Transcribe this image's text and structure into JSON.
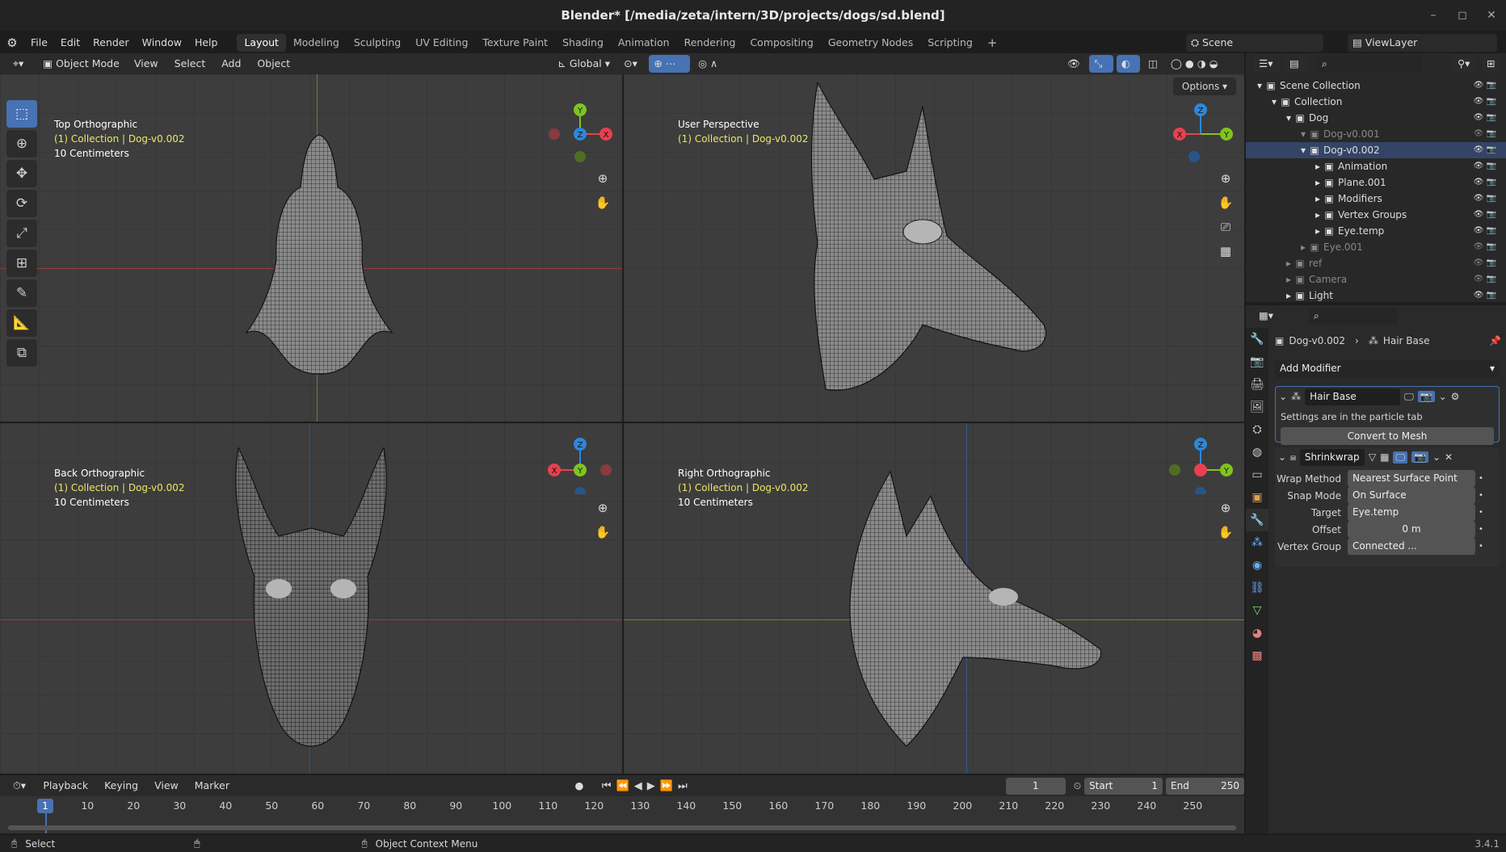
{
  "window": {
    "title": "Blender* [/media/zeta/intern/3D/projects/dogs/sd.blend]",
    "minimize": "–",
    "maximize": "◻",
    "close": "✕"
  },
  "menus": [
    "File",
    "Edit",
    "Render",
    "Window",
    "Help"
  ],
  "workspaces": [
    "Layout",
    "Modeling",
    "Sculpting",
    "UV Editing",
    "Texture Paint",
    "Shading",
    "Animation",
    "Rendering",
    "Compositing",
    "Geometry Nodes",
    "Scripting"
  ],
  "workspace_add": "+",
  "scene": {
    "label": "Scene"
  },
  "view_layer": {
    "label": "ViewLayer"
  },
  "viewport_header": {
    "mode": "Object Mode",
    "menus": [
      "View",
      "Select",
      "Add",
      "Object"
    ],
    "orientation": "Global",
    "options": "Options"
  },
  "viewports": [
    {
      "title": "Top Orthographic",
      "collection": "(1) Collection | Dog-v0.002",
      "scale": "10 Centimeters",
      "axes": [
        "Y",
        "X",
        "Z"
      ]
    },
    {
      "title": "User Perspective",
      "collection": "(1) Collection | Dog-v0.002",
      "scale": "",
      "axes": [
        "Z",
        "X",
        "Y"
      ]
    },
    {
      "title": "Back Orthographic",
      "collection": "(1) Collection | Dog-v0.002",
      "scale": "10 Centimeters",
      "axes": [
        "Z",
        "X",
        "Y"
      ]
    },
    {
      "title": "Right Orthographic",
      "collection": "(1) Collection | Dog-v0.002",
      "scale": "10 Centimeters",
      "axes": [
        "Z",
        "Y"
      ]
    }
  ],
  "outliner": {
    "rows": [
      {
        "label": "Scene Collection",
        "indent": 0,
        "dim": false
      },
      {
        "label": "Collection",
        "indent": 1,
        "dim": false
      },
      {
        "label": "Dog",
        "indent": 2,
        "dim": false
      },
      {
        "label": "Dog-v0.001",
        "indent": 3,
        "dim": true
      },
      {
        "label": "Dog-v0.002",
        "indent": 3,
        "dim": false
      },
      {
        "label": "Animation",
        "indent": 4,
        "dim": false
      },
      {
        "label": "Plane.001",
        "indent": 4,
        "dim": false
      },
      {
        "label": "Modifiers",
        "indent": 4,
        "dim": false
      },
      {
        "label": "Vertex Groups",
        "indent": 4,
        "dim": false
      },
      {
        "label": "Eye.temp",
        "indent": 4,
        "dim": false
      },
      {
        "label": "Eye.001",
        "indent": 3,
        "dim": true
      },
      {
        "label": "ref",
        "indent": 2,
        "dim": true
      },
      {
        "label": "Camera",
        "indent": 2,
        "dim": true
      },
      {
        "label": "Light",
        "indent": 2,
        "dim": false
      }
    ]
  },
  "properties": {
    "breadcrumb_object": "Dog-v0.002",
    "breadcrumb_modifier": "Hair Base",
    "add_modifier": "Add Modifier",
    "hair_base": {
      "name": "Hair Base",
      "note": "Settings are in the particle tab",
      "convert": "Convert to Mesh"
    },
    "shrinkwrap": {
      "name": "Shrinkwrap",
      "rows": [
        {
          "label": "Wrap Method",
          "value": "Nearest Surface Point"
        },
        {
          "label": "Snap Mode",
          "value": "On Surface"
        },
        {
          "label": "Target",
          "value": "Eye.temp"
        },
        {
          "label": "Offset",
          "value": "0 m"
        },
        {
          "label": "Vertex Group",
          "value": "Connected ..."
        }
      ]
    }
  },
  "timeline": {
    "menus": [
      "Playback",
      "Keying",
      "View",
      "Marker"
    ],
    "current_frame": "1",
    "start_label": "Start",
    "start": "1",
    "end_label": "End",
    "end": "250",
    "ticks": [
      "10",
      "20",
      "30",
      "40",
      "50",
      "60",
      "70",
      "80",
      "90",
      "100",
      "110",
      "120",
      "130",
      "140",
      "150",
      "160",
      "170",
      "180",
      "190",
      "200",
      "210",
      "220",
      "230",
      "240",
      "250"
    ],
    "playhead": "1"
  },
  "status": {
    "select": "Select",
    "context": "Object Context Menu",
    "version": "3.4.1"
  },
  "colors": {
    "accent": "#4772b3",
    "x_axis": "#e8404f",
    "y_axis": "#7fc41e",
    "z_axis": "#2e87d9"
  }
}
